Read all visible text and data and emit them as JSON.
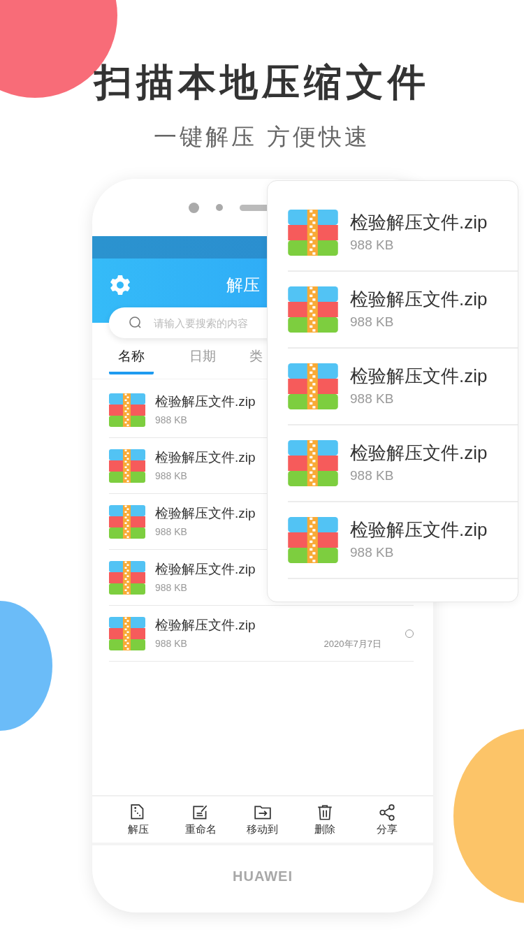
{
  "headline": "扫描本地压缩文件",
  "subtitle": "一键解压 方便快速",
  "phone": {
    "app_title": "解压",
    "search": {
      "placeholder": "请输入要搜索的内容"
    },
    "tabs": [
      {
        "label": "名称",
        "selected": true
      },
      {
        "label": "日期",
        "selected": false
      },
      {
        "label": "类",
        "selected": false
      }
    ],
    "files": [
      {
        "name": "检验解压文件.zip",
        "size": "988 KB"
      },
      {
        "name": "检验解压文件.zip",
        "size": "988 KB"
      },
      {
        "name": "检验解压文件.zip",
        "size": "988 KB"
      },
      {
        "name": "检验解压文件.zip",
        "size": "988 KB"
      },
      {
        "name": "检验解压文件.zip",
        "size": "988 KB",
        "date": "2020年7月7日",
        "selected": false
      }
    ],
    "toolbar": [
      {
        "label": "解压",
        "kind": "extract"
      },
      {
        "label": "重命名",
        "kind": "rename"
      },
      {
        "label": "移动到",
        "kind": "move"
      },
      {
        "label": "删除",
        "kind": "delete"
      },
      {
        "label": "分享",
        "kind": "share"
      }
    ],
    "brand": "HUAWEI"
  },
  "popup_files": [
    {
      "name": "检验解压文件.zip",
      "size": "988 KB"
    },
    {
      "name": "检验解压文件.zip",
      "size": "988 KB"
    },
    {
      "name": "检验解压文件.zip",
      "size": "988 KB"
    },
    {
      "name": "检验解压文件.zip",
      "size": "988 KB"
    },
    {
      "name": "检验解压文件.zip",
      "size": "988 KB"
    }
  ]
}
